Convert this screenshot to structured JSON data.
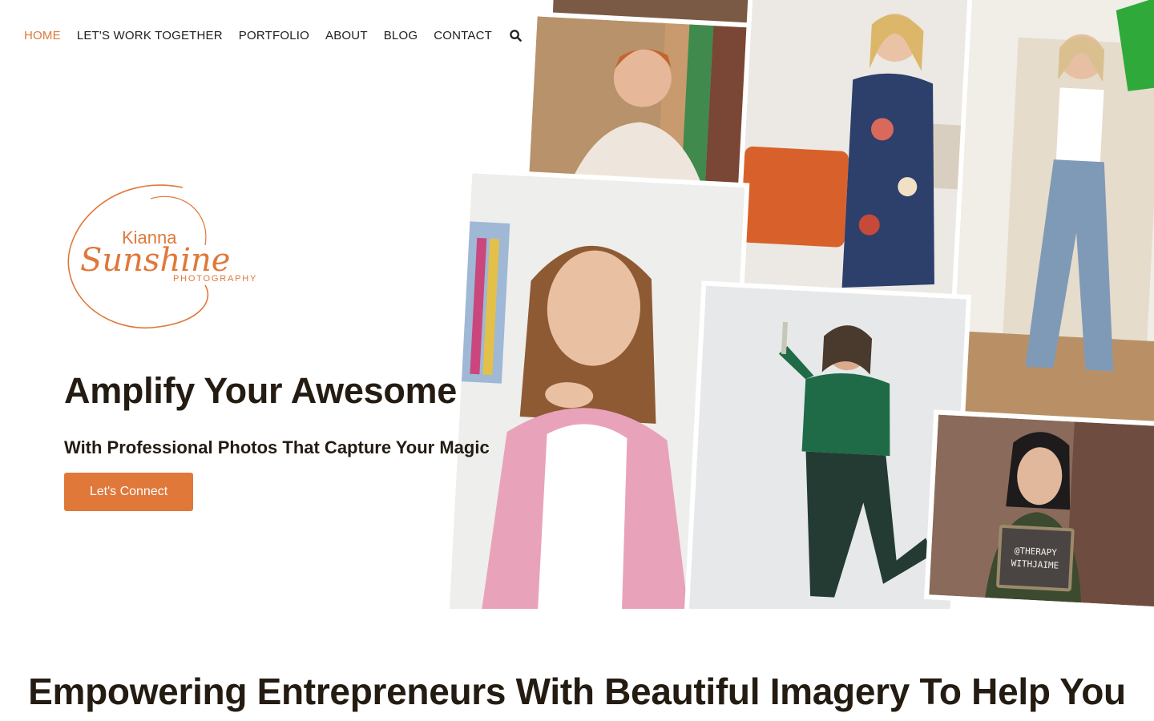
{
  "nav": {
    "items": [
      {
        "label": "HOME",
        "active": true
      },
      {
        "label": "LET'S WORK TOGETHER",
        "active": false
      },
      {
        "label": "PORTFOLIO",
        "active": false
      },
      {
        "label": "ABOUT",
        "active": false
      },
      {
        "label": "BLOG",
        "active": false
      },
      {
        "label": "CONTACT",
        "active": false
      }
    ],
    "search_icon": "search-icon"
  },
  "logo": {
    "line1": "Kianna",
    "line2": "Sunshine",
    "line3": "PHOTOGRAPHY"
  },
  "hero": {
    "title": "Amplify Your Awesome",
    "subtitle": "With Professional Photos That Capture Your Magic",
    "cta_label": "Let's Connect"
  },
  "photo_sign": {
    "line1": "@THERAPY",
    "line2": "WITHJAIME"
  },
  "section": {
    "heading": "Empowering Entrepreneurs With Beautiful Imagery To Help You"
  },
  "colors": {
    "accent": "#e0783a",
    "text_dark": "#241c12"
  }
}
